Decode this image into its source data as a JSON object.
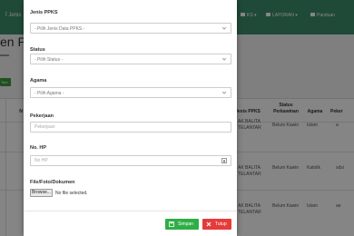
{
  "background": {
    "nav_home": "أ Jenis",
    "nav_items": [
      {
        "label": "KS ▾",
        "icon": "chart-icon"
      },
      {
        "label": "LAPORAN ▾",
        "icon": "chart-icon"
      },
      {
        "label": "Panduan",
        "icon": "book-icon"
      }
    ],
    "page_title": "en P",
    "add_button": "Tam",
    "table": {
      "headers": [
        {
          "key": "no",
          "label": "N"
        },
        {
          "key": "jenis",
          "label": "Jenis PPKS"
        },
        {
          "key": "status",
          "label": "Status Perkawinan"
        },
        {
          "key": "agama",
          "label": "Agama"
        },
        {
          "key": "pekerjaan",
          "label": "Peker"
        }
      ],
      "rows": [
        {
          "no": "",
          "jenis": "AK BALITA TELANTAR",
          "status": "Belum Kawin",
          "agama": "Islam",
          "pekerjaan": "a"
        },
        {
          "no": "",
          "jenis": "AK BALITA TELANTAR",
          "status": "Belum Kawin",
          "agama": "Katolik",
          "pekerjaan": "sdsi"
        },
        {
          "no": "",
          "jenis": "AK BALITA TELANTAR",
          "status": "Belum Kawin",
          "agama": "Islam",
          "pekerjaan": "ae"
        }
      ]
    }
  },
  "modal": {
    "fields": {
      "jenis_ppks": {
        "label": "Jenis PPKS",
        "value": "- Pilih Jenis Data PPKS -"
      },
      "status": {
        "label": "Status",
        "value": "- Pilih Status -"
      },
      "agama": {
        "label": "Agama",
        "value": "- Pilih Agama -"
      },
      "pekerjaan": {
        "label": "Pekerjaan",
        "value": "",
        "placeholder": "Pekerjaan"
      },
      "no_hp": {
        "label": "No. HP",
        "value": "",
        "placeholder": "No HP"
      },
      "file": {
        "label": "File/Foto/Dokumen",
        "button_label": "Browse...",
        "status": "No file selected."
      }
    },
    "buttons": {
      "save": {
        "label": "Simpan",
        "icon": "save-icon",
        "color": "#2fae46"
      },
      "close": {
        "label": "Tutup",
        "icon": "close-icon",
        "color": "#e63b3b"
      }
    }
  },
  "colors": {
    "navbar": "#3f8f6c",
    "backdrop": "rgba(0,0,0,0.48)",
    "success": "#2fae46",
    "danger": "#e63b3b"
  }
}
